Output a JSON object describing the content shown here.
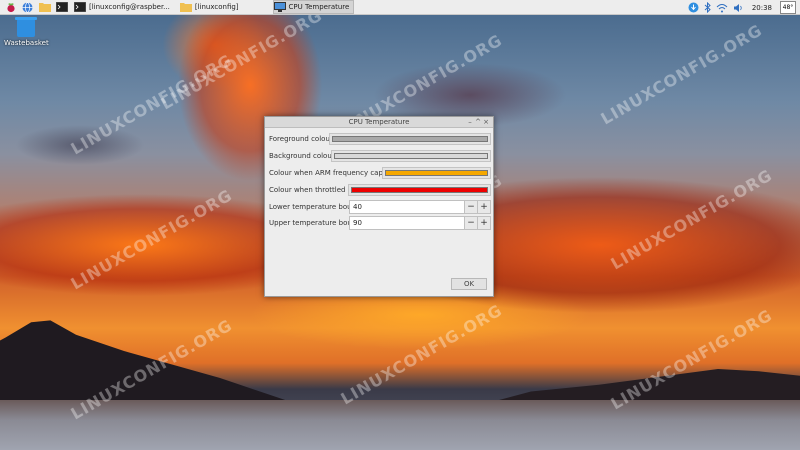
{
  "taskbar": {
    "tasks": [
      {
        "label": "[linuxconfig@raspber...",
        "icon": "terminal-icon"
      },
      {
        "label": "[linuxconfig]",
        "icon": "folder-icon"
      },
      {
        "label": "CPU Temperature",
        "icon": "monitor-icon"
      }
    ],
    "clock": "20:38",
    "cpu_temp": "48°"
  },
  "desktop": {
    "icon_label": "Wastebasket",
    "watermark": "LINUXCONFIG.ORG"
  },
  "dialog": {
    "title": "CPU Temperature",
    "window_buttons": [
      "–",
      "^",
      "×"
    ],
    "rows": [
      {
        "label": "Foreground colour",
        "swatch": "#a9a9a9"
      },
      {
        "label": "Background colour",
        "swatch": "#d8d8d8"
      },
      {
        "label": "Colour when ARM frequency capped",
        "swatch": "#f5a800"
      },
      {
        "label": "Colour when throttled",
        "swatch": "#ee0000"
      }
    ],
    "lower_bound_label": "Lower temperature bound",
    "lower_bound_value": "40",
    "upper_bound_label": "Upper temperature bound",
    "upper_bound_value": "90",
    "minus": "−",
    "plus": "+",
    "ok_label": "OK"
  },
  "colors": {
    "taskbar_bg": "#ededed",
    "dialog_bg": "#ededed",
    "accent_blue": "#2f8fe0"
  }
}
